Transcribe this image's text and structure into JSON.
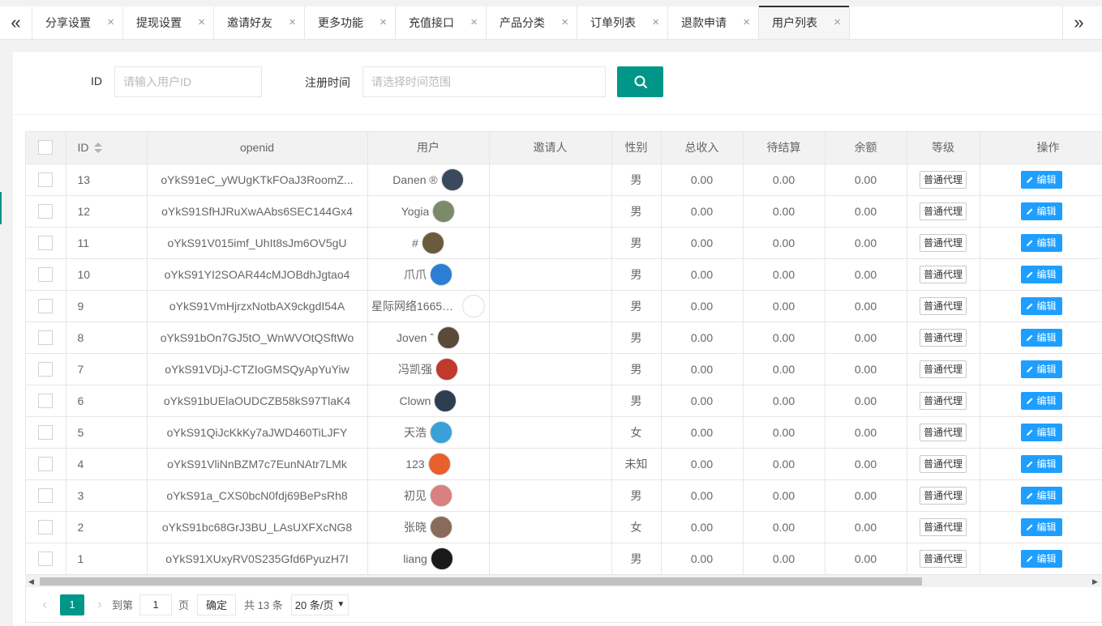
{
  "tabs": [
    {
      "label": "分享设置",
      "active": false
    },
    {
      "label": "提现设置",
      "active": false
    },
    {
      "label": "邀请好友",
      "active": false
    },
    {
      "label": "更多功能",
      "active": false
    },
    {
      "label": "充值接口",
      "active": false
    },
    {
      "label": "产品分类",
      "active": false
    },
    {
      "label": "订单列表",
      "active": false
    },
    {
      "label": "退款申请",
      "active": false
    },
    {
      "label": "用户列表",
      "active": true
    }
  ],
  "tab_close_glyph": "×",
  "nav": {
    "left_glyph": "«",
    "right_glyph": "»"
  },
  "search": {
    "id_label": "ID",
    "id_placeholder": "请输入用户ID",
    "time_label": "注册时间",
    "time_placeholder": "请选择时间范围"
  },
  "table": {
    "headers": {
      "id": "ID",
      "openid": "openid",
      "user": "用户",
      "inviter": "邀请人",
      "gender": "性别",
      "total_income": "总收入",
      "pending": "待结算",
      "balance": "余额",
      "level": "等级",
      "action": "操作"
    },
    "edit_label": "编辑",
    "rows": [
      {
        "id": "13",
        "openid": "oYkS91eC_yWUgKTkFOaJ3RoomZ...",
        "user": "Danen ®",
        "inviter": "",
        "gender": "男",
        "total_income": "0.00",
        "pending": "0.00",
        "balance": "0.00",
        "level": "普通代理"
      },
      {
        "id": "12",
        "openid": "oYkS91SfHJRuXwAAbs6SEC144Gx4",
        "user": "Yogia",
        "inviter": "",
        "gender": "男",
        "total_income": "0.00",
        "pending": "0.00",
        "balance": "0.00",
        "level": "普通代理"
      },
      {
        "id": "11",
        "openid": "oYkS91V015imf_UhIt8sJm6OV5gU",
        "user": "#",
        "inviter": "",
        "gender": "男",
        "total_income": "0.00",
        "pending": "0.00",
        "balance": "0.00",
        "level": "普通代理"
      },
      {
        "id": "10",
        "openid": "oYkS91YI2SOAR44cMJOBdhJgtao4",
        "user": "爪爪",
        "inviter": "",
        "gender": "男",
        "total_income": "0.00",
        "pending": "0.00",
        "balance": "0.00",
        "level": "普通代理"
      },
      {
        "id": "9",
        "openid": "oYkS91VmHjrzxNotbAX9ckgdI54A",
        "user": "星际网络166500...",
        "inviter": "",
        "gender": "男",
        "total_income": "0.00",
        "pending": "0.00",
        "balance": "0.00",
        "level": "普通代理"
      },
      {
        "id": "8",
        "openid": "oYkS91bOn7GJ5tO_WnWVOtQSftWo",
        "user": "Joven ˆ",
        "inviter": "",
        "gender": "男",
        "total_income": "0.00",
        "pending": "0.00",
        "balance": "0.00",
        "level": "普通代理"
      },
      {
        "id": "7",
        "openid": "oYkS91VDjJ-CTZIoGMSQyApYuYiw",
        "user": "冯凯强",
        "inviter": "",
        "gender": "男",
        "total_income": "0.00",
        "pending": "0.00",
        "balance": "0.00",
        "level": "普通代理"
      },
      {
        "id": "6",
        "openid": "oYkS91bUElaOUDCZB58kS97TlaK4",
        "user": "Clown",
        "inviter": "",
        "gender": "男",
        "total_income": "0.00",
        "pending": "0.00",
        "balance": "0.00",
        "level": "普通代理"
      },
      {
        "id": "5",
        "openid": "oYkS91QiJcKkKy7aJWD460TiLJFY",
        "user": "天浩",
        "inviter": "",
        "gender": "女",
        "total_income": "0.00",
        "pending": "0.00",
        "balance": "0.00",
        "level": "普通代理"
      },
      {
        "id": "4",
        "openid": "oYkS91VliNnBZM7c7EunNAtr7LMk",
        "user": "123",
        "inviter": "",
        "gender": "未知",
        "total_income": "0.00",
        "pending": "0.00",
        "balance": "0.00",
        "level": "普通代理"
      },
      {
        "id": "3",
        "openid": "oYkS91a_CXS0bcN0fdj69BePsRh8",
        "user": "初见",
        "inviter": "",
        "gender": "男",
        "total_income": "0.00",
        "pending": "0.00",
        "balance": "0.00",
        "level": "普通代理"
      },
      {
        "id": "2",
        "openid": "oYkS91bc68GrJ3BU_LAsUXFXcNG8",
        "user": "张晓",
        "inviter": "",
        "gender": "女",
        "total_income": "0.00",
        "pending": "0.00",
        "balance": "0.00",
        "level": "普通代理"
      },
      {
        "id": "1",
        "openid": "oYkS91XUxyRV0S235Gfd6PyuzH7I",
        "user": "liang",
        "inviter": "",
        "gender": "男",
        "total_income": "0.00",
        "pending": "0.00",
        "balance": "0.00",
        "level": "普通代理"
      }
    ],
    "avatar_colors": [
      "#3a4a5c",
      "#7a8a6a",
      "#6b5b3e",
      "#2a7fd4",
      "#ffffff",
      "#5a4a3a",
      "#c0392b",
      "#2c3e50",
      "#3aa0d8",
      "#e8602c",
      "#d98080",
      "#8a6a5a",
      "#1a1a1a"
    ]
  },
  "pager": {
    "prev_glyph": "‹",
    "next_glyph": "›",
    "current_page": "1",
    "goto_label": "到第",
    "goto_value": "1",
    "page_unit": "页",
    "confirm_label": "确定",
    "total_text": "共 13 条",
    "page_size_text": "20 条/页"
  },
  "colors": {
    "primary": "#009688",
    "edit": "#1e9fff"
  }
}
